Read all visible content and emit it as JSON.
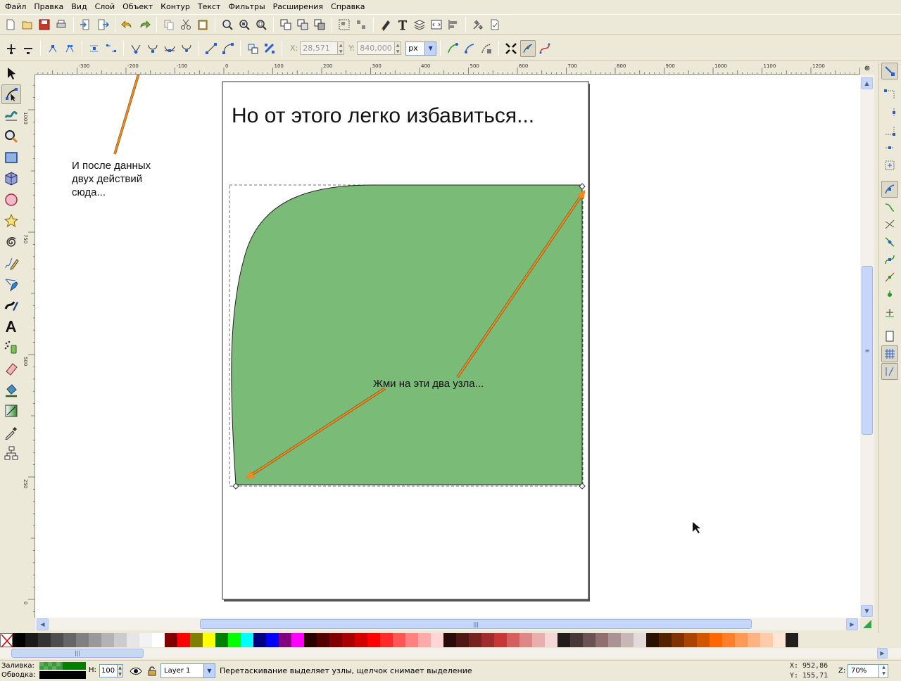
{
  "menubar": [
    "Файл",
    "Правка",
    "Вид",
    "Слой",
    "Объект",
    "Контур",
    "Текст",
    "Фильтры",
    "Расширения",
    "Справка"
  ],
  "node_toolbar": {
    "x_label": "X:",
    "x_value": "28,571",
    "y_label": "Y:",
    "y_value": "840,000",
    "unit": "px"
  },
  "ruler": {
    "h_ticks": [
      "-300",
      "-200",
      "-100",
      "0",
      "100",
      "200",
      "300",
      "400",
      "500",
      "600",
      "700",
      "800",
      "900",
      "1000",
      "1100",
      "1200"
    ],
    "v_ticks": [
      "1000",
      "750",
      "500",
      "250",
      "0"
    ]
  },
  "canvas": {
    "page_title": "Но от этого легко избавиться...",
    "note_left": [
      "И после данных",
      "двух действий",
      "сюда..."
    ],
    "note_center": "Жми на эти два узла...",
    "fill_color": "#7bbb78",
    "arrow_color": "#f08a1e"
  },
  "palette": [
    "#000000",
    "#1a1a1a",
    "#333333",
    "#4d4d4d",
    "#666666",
    "#808080",
    "#999999",
    "#b3b3b3",
    "#cccccc",
    "#e6e6e6",
    "#f2f2f2",
    "#ffffff",
    "#800000",
    "#ff0000",
    "#808000",
    "#ffff00",
    "#008000",
    "#00ff00",
    "#00ffff",
    "#000080",
    "#0000ff",
    "#800080",
    "#ff00ff",
    "#2b0000",
    "#550000",
    "#800000",
    "#aa0000",
    "#d40000",
    "#ff0000",
    "#ff2a2a",
    "#ff5555",
    "#ff8080",
    "#ffaaaa",
    "#ffd5d5",
    "#280b0b",
    "#501616",
    "#782121",
    "#a02c2c",
    "#c83737",
    "#d35f5f",
    "#de8787",
    "#e9afaf",
    "#f4d7d7",
    "#241c1c",
    "#483737",
    "#6c5353",
    "#916f6f",
    "#ac9393",
    "#c8b7b7",
    "#e3dbdb",
    "#2b1100",
    "#552200",
    "#803300",
    "#aa4400",
    "#d45500",
    "#ff6600",
    "#ff7f2a",
    "#ff9955",
    "#ffb380",
    "#ffccaa",
    "#ffe6d5",
    "#241f1c"
  ],
  "status": {
    "fill_label": "Заливка:",
    "stroke_label": "Обводка:",
    "h_label": "H:",
    "h_value": "100",
    "stroke_width": "1",
    "layer": "Layer 1",
    "hint": "Перетаскивание выделяет узлы, щелчок снимает выделение",
    "x_label": "X:",
    "x_value": "952,86",
    "y_label": "Y:",
    "y_value": "155,71",
    "z_label": "Z:",
    "zoom": "70%"
  }
}
